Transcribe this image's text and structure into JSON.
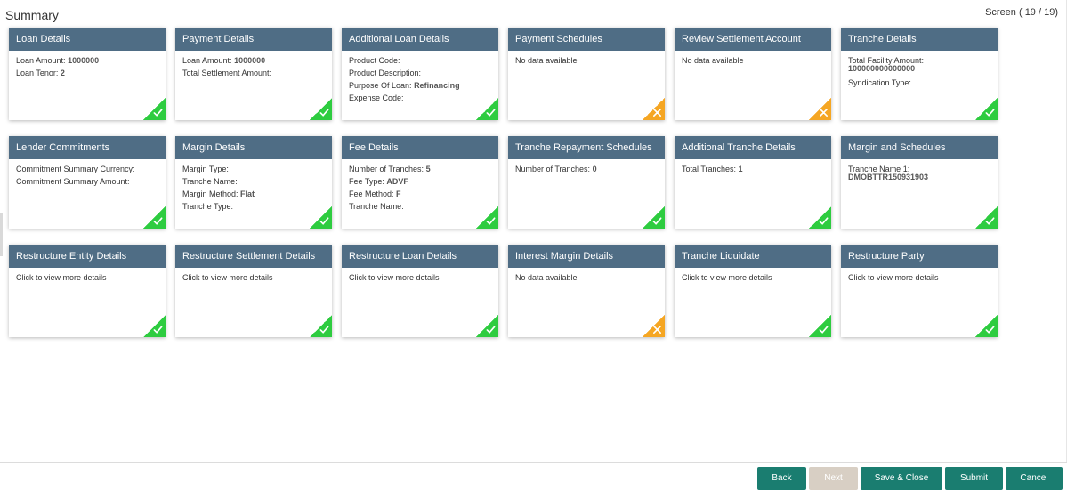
{
  "page": {
    "title": "Summary",
    "screen_label": "Screen ( 19 / 19)"
  },
  "cards": [
    {
      "title": "Loan Details",
      "status": "complete",
      "lines": [
        {
          "label": "Loan Amount:",
          "value": "1000000"
        },
        {
          "label": "Loan Tenor:",
          "value": "2"
        }
      ]
    },
    {
      "title": "Payment Details",
      "status": "complete",
      "lines": [
        {
          "label": "Loan Amount:",
          "value": "1000000"
        },
        {
          "label": "Total Settlement Amount:",
          "value": ""
        }
      ]
    },
    {
      "title": "Additional Loan Details",
      "status": "complete",
      "lines": [
        {
          "label": "Product Code:",
          "value": ""
        },
        {
          "label": "Product Description:",
          "value": ""
        },
        {
          "label": "Purpose Of Loan:",
          "value": "Refinancing"
        },
        {
          "label": "Expense Code:",
          "value": ""
        }
      ]
    },
    {
      "title": "Payment Schedules",
      "status": "incomplete",
      "lines": [
        {
          "label": "No data available",
          "value": ""
        }
      ]
    },
    {
      "title": "Review Settlement Account",
      "status": "incomplete",
      "lines": [
        {
          "label": "No data available",
          "value": ""
        }
      ]
    },
    {
      "title": "Tranche Details",
      "status": "complete",
      "lines": [
        {
          "label": "Total Facility Amount:",
          "value": "100000000000000",
          "block": true
        },
        {
          "label": "Syndication Type:",
          "value": ""
        }
      ]
    },
    {
      "title": "Lender Commitments",
      "status": "complete",
      "lines": [
        {
          "label": "Commitment Summary Currency:",
          "value": ""
        },
        {
          "label": "Commitment Summary Amount:",
          "value": ""
        }
      ]
    },
    {
      "title": "Margin Details",
      "status": "complete",
      "lines": [
        {
          "label": "Margin Type:",
          "value": ""
        },
        {
          "label": "Tranche Name:",
          "value": ""
        },
        {
          "label": "Margin Method:",
          "value": "Flat"
        },
        {
          "label": "Tranche Type:",
          "value": ""
        }
      ]
    },
    {
      "title": "Fee Details",
      "status": "complete",
      "lines": [
        {
          "label": "Number of Tranches:",
          "value": "5"
        },
        {
          "label": "Fee Type:",
          "value": "ADVF"
        },
        {
          "label": "Fee Method:",
          "value": "F"
        },
        {
          "label": "Tranche Name:",
          "value": ""
        }
      ]
    },
    {
      "title": "Tranche Repayment Schedules",
      "status": "complete",
      "lines": [
        {
          "label": "Number of Tranches:",
          "value": "0"
        }
      ]
    },
    {
      "title": "Additional Tranche Details",
      "status": "complete",
      "lines": [
        {
          "label": "Total Tranches:",
          "value": "1"
        }
      ]
    },
    {
      "title": "Margin and Schedules",
      "status": "complete",
      "lines": [
        {
          "label": "Tranche Name 1:",
          "value": "DMOBTTR150931903",
          "block": true
        }
      ]
    },
    {
      "title": "Restructure Entity Details",
      "status": "complete",
      "lines": [
        {
          "label": "Click to view more details",
          "value": ""
        }
      ]
    },
    {
      "title": "Restructure Settlement Details",
      "status": "complete",
      "lines": [
        {
          "label": "Click to view more details",
          "value": ""
        }
      ]
    },
    {
      "title": "Restructure Loan Details",
      "status": "complete",
      "lines": [
        {
          "label": "Click to view more details",
          "value": ""
        }
      ]
    },
    {
      "title": "Interest Margin Details",
      "status": "incomplete",
      "lines": [
        {
          "label": "No data available",
          "value": ""
        }
      ]
    },
    {
      "title": "Tranche Liquidate",
      "status": "complete",
      "lines": [
        {
          "label": "Click to view more details",
          "value": ""
        }
      ]
    },
    {
      "title": "Restructure Party",
      "status": "complete",
      "lines": [
        {
          "label": "Click to view more details",
          "value": ""
        }
      ]
    }
  ],
  "status_icons": {
    "complete": "check-icon",
    "incomplete": "cross-icon"
  },
  "colors": {
    "card_header": "#4f6d85",
    "complete": "#2ecc40",
    "incomplete": "#f5a623",
    "primary_button": "#1a7d70",
    "disabled_button": "#d8cfc4"
  },
  "footer": {
    "back": "Back",
    "next": "Next",
    "save_close": "Save & Close",
    "submit": "Submit",
    "cancel": "Cancel"
  }
}
